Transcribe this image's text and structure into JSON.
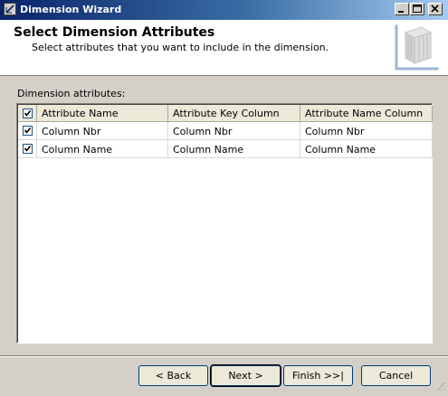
{
  "window": {
    "title": "Dimension Wizard"
  },
  "header": {
    "title": "Select Dimension Attributes",
    "subtitle": "Select attributes that you want to include in the dimension."
  },
  "attributes": {
    "label": "Dimension attributes:",
    "columns": [
      "Attribute Name",
      "Attribute Key Column",
      "Attribute Name Column"
    ],
    "select_all_checked": true,
    "rows": [
      {
        "checked": true,
        "name": "Column Nbr",
        "key_column": "Column Nbr",
        "name_column": "Column Nbr"
      },
      {
        "checked": true,
        "name": "Column Name",
        "key_column": "Column Name",
        "name_column": "Column Name"
      }
    ]
  },
  "buttons": {
    "back": "< Back",
    "next": "Next >",
    "finish": "Finish >>|",
    "cancel": "Cancel"
  },
  "icons": {
    "app": "wizard-icon",
    "minimize": "minimize-icon",
    "maximize": "maximize-icon",
    "close": "close-icon",
    "header_art": "dimension-cube-icon",
    "resize": "resize-grip-icon"
  }
}
